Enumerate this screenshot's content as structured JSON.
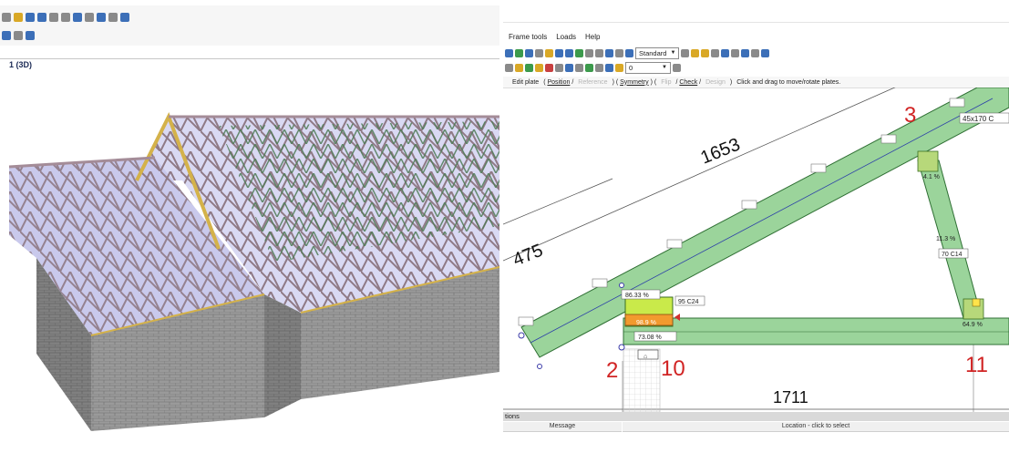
{
  "left_view": {
    "label": "1 (3D)"
  },
  "right_view": {
    "menu": [
      "Frame tools",
      "Loads",
      "Help"
    ],
    "toolbar": {
      "profile_select": "Standard",
      "layer_select": "0"
    },
    "command_bar": {
      "title": "Edit plate",
      "open_paren": "(",
      "position": "Position",
      "reference": "Reference",
      "symmetry": "Symmetry",
      "flip": "Flip",
      "check": "Check",
      "design": "Design",
      "hint": "Click and drag to move/rotate plates."
    },
    "drawing": {
      "dim_top": "1653",
      "dim_left": "475",
      "dim_bottom": "1711",
      "node_3": "3",
      "node_2": "2",
      "node_10": "10",
      "node_11": "11",
      "section_rafter": "45x170 C",
      "section_web": "70 C14",
      "section_chord": "95 C24",
      "pct_plate_top": "86.33 %",
      "pct_plate_mid": "98.9 %",
      "pct_chord": "73.08 %",
      "pct_web": "11.3 %",
      "pct_right": "64.9 %",
      "pct_apex": "4.1 %"
    },
    "status": {
      "section": "tions",
      "col_message": "Message",
      "col_location": "Location - click to select"
    }
  }
}
